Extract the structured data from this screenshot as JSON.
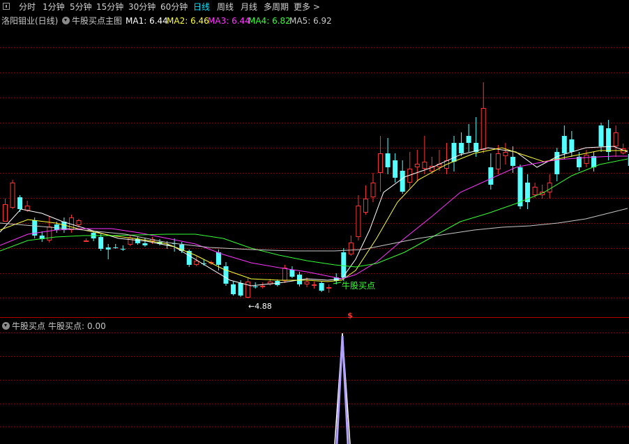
{
  "toolbar": {
    "periods": [
      "分时",
      "1分钟",
      "5分钟",
      "15分钟",
      "30分钟",
      "60分钟",
      "日线",
      "周线",
      "月线",
      "多周期",
      "更多 >"
    ],
    "active": "日线"
  },
  "main_panel": {
    "stock": "洛阳钼业(日线)",
    "indicator": "牛股买点主图",
    "ma": [
      {
        "label": "MA1:",
        "value": "6.44",
        "color": "#ffffff"
      },
      {
        "label": "MA2:",
        "value": "6.46",
        "color": "#ffff33"
      },
      {
        "label": "MA3:",
        "value": "6.44",
        "color": "#ff33ff"
      },
      {
        "label": "MA4:",
        "value": "6.82",
        "color": "#33ff33"
      },
      {
        "label": "MA5:",
        "value": "6.92",
        "color": "#c8c8c8"
      }
    ],
    "low_annotation": "←4.88",
    "signal_label": "牛股买点",
    "signal_marker": "$"
  },
  "sub_panel": {
    "indicator": "牛股买点",
    "value_label": "牛股买点:",
    "value": "0.00"
  },
  "colors": {
    "up": "#ff3333",
    "down": "#54ffff",
    "grid": "#8b0000",
    "active_tab": "#00e5ff",
    "signal_text": "#33ff33",
    "marker": "#ff3333",
    "spike": "#b3a1ff"
  }
}
